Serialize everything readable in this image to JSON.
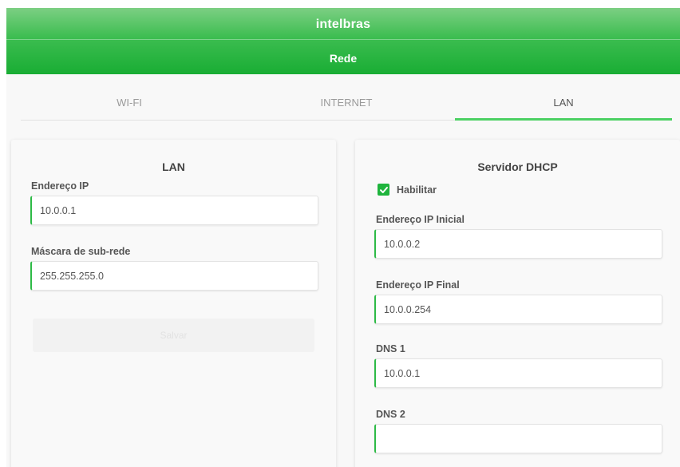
{
  "header": {
    "brand": "intelbras",
    "section_title": "Rede"
  },
  "tabs": [
    {
      "label": "WI-FI",
      "active": false
    },
    {
      "label": "INTERNET",
      "active": false
    },
    {
      "label": "LAN",
      "active": true
    }
  ],
  "lan_card": {
    "title": "LAN",
    "ip_label": "Endereço IP",
    "ip_value": "10.0.0.1",
    "mask_label": "Máscara de sub-rede",
    "mask_value": "255.255.255.0",
    "save_label": "Salvar"
  },
  "dhcp_card": {
    "title": "Servidor DHCP",
    "enable_label": "Habilitar",
    "enable_checked": true,
    "start_label": "Endereço IP Inicial",
    "start_value": "10.0.0.2",
    "end_label": "Endereço IP Final",
    "end_value": "10.0.0.254",
    "dns1_label": "DNS 1",
    "dns1_value": "10.0.0.1",
    "dns2_label": "DNS 2",
    "dns2_value": ""
  },
  "colors": {
    "accent": "#1fb43d",
    "header_gradient_top": "#7ccf83",
    "header_gradient_bottom": "#19ad34"
  }
}
